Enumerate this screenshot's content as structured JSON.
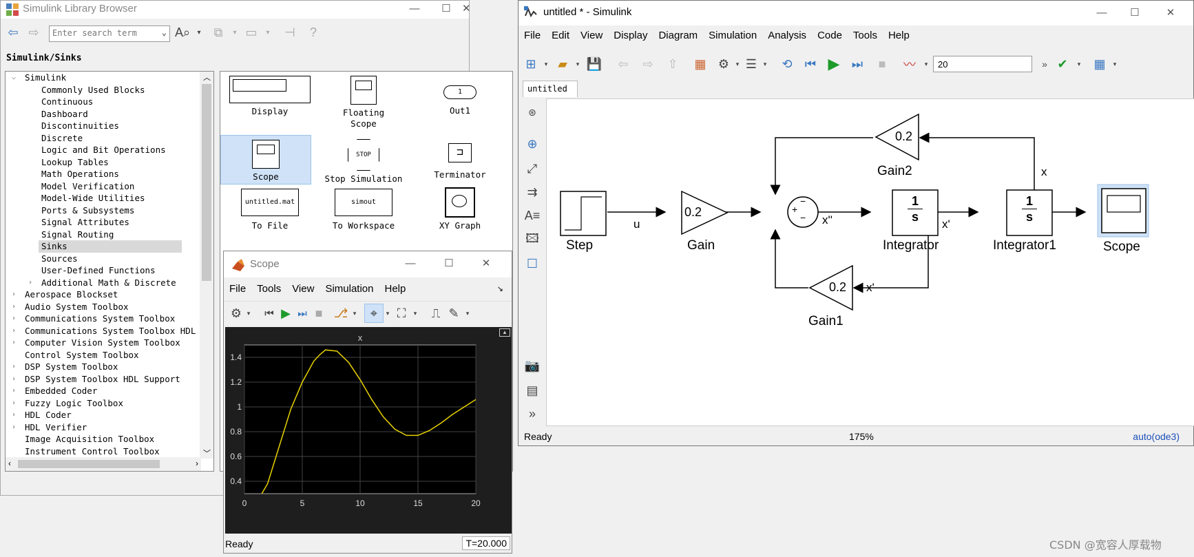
{
  "library": {
    "title": "Simulink Library Browser",
    "search_placeholder": "Enter search term",
    "path": "Simulink/Sinks",
    "tree": [
      {
        "label": "Simulink",
        "level": 0,
        "arrow": "v"
      },
      {
        "label": "Commonly Used Blocks",
        "level": 1
      },
      {
        "label": "Continuous",
        "level": 1
      },
      {
        "label": "Dashboard",
        "level": 1
      },
      {
        "label": "Discontinuities",
        "level": 1
      },
      {
        "label": "Discrete",
        "level": 1
      },
      {
        "label": "Logic and Bit Operations",
        "level": 1
      },
      {
        "label": "Lookup Tables",
        "level": 1
      },
      {
        "label": "Math Operations",
        "level": 1
      },
      {
        "label": "Model Verification",
        "level": 1
      },
      {
        "label": "Model-Wide Utilities",
        "level": 1
      },
      {
        "label": "Ports & Subsystems",
        "level": 1
      },
      {
        "label": "Signal Attributes",
        "level": 1
      },
      {
        "label": "Signal Routing",
        "level": 1
      },
      {
        "label": "Sinks",
        "level": 1,
        "selected": true
      },
      {
        "label": "Sources",
        "level": 1
      },
      {
        "label": "User-Defined Functions",
        "level": 1
      },
      {
        "label": "Additional Math & Discrete",
        "level": 1,
        "arrow": ">"
      },
      {
        "label": "Aerospace Blockset",
        "level": 0,
        "arrow": ">"
      },
      {
        "label": "Audio System Toolbox",
        "level": 0,
        "arrow": ">"
      },
      {
        "label": "Communications System Toolbox",
        "level": 0,
        "arrow": ">"
      },
      {
        "label": "Communications System Toolbox HDL",
        "level": 0,
        "arrow": ">"
      },
      {
        "label": "Computer Vision System Toolbox",
        "level": 0,
        "arrow": ">"
      },
      {
        "label": "Control System Toolbox",
        "level": 0
      },
      {
        "label": "DSP System Toolbox",
        "level": 0,
        "arrow": ">"
      },
      {
        "label": "DSP System Toolbox HDL Support",
        "level": 0,
        "arrow": ">"
      },
      {
        "label": "Embedded Coder",
        "level": 0,
        "arrow": ">"
      },
      {
        "label": "Fuzzy Logic Toolbox",
        "level": 0,
        "arrow": ">"
      },
      {
        "label": "HDL Coder",
        "level": 0,
        "arrow": ">"
      },
      {
        "label": "HDL Verifier",
        "level": 0,
        "arrow": ">"
      },
      {
        "label": "Image Acquisition Toolbox",
        "level": 0
      },
      {
        "label": "Instrument Control Toolbox",
        "level": 0
      }
    ],
    "blocks": {
      "display": "Display",
      "floating_scope": "Floating Scope",
      "out1": "Out1",
      "out1_port": "1",
      "scope": "Scope",
      "stop_simulation": "Stop Simulation",
      "stop_text": "STOP",
      "terminator": "Terminator",
      "to_file": "To File",
      "to_file_text": "untitled.mat",
      "to_workspace": "To Workspace",
      "to_workspace_text": "simout",
      "xy_graph": "XY Graph"
    }
  },
  "scope": {
    "title": "Scope",
    "menu": [
      "File",
      "Tools",
      "View",
      "Simulation",
      "Help"
    ],
    "status": "Ready",
    "time": "T=20.000"
  },
  "chart_data": {
    "type": "line",
    "title": "x",
    "xlim": [
      0,
      20
    ],
    "ylim": [
      0.3,
      1.5
    ],
    "xticks": [
      "0",
      "5",
      "10",
      "15",
      "20"
    ],
    "yticks": [
      "0.4",
      "0.6",
      "0.8",
      "1",
      "1.2",
      "1.4"
    ],
    "grid": true,
    "line_color": "#e8d200",
    "background": "#000000",
    "series": [
      {
        "x": [
          1.5,
          2,
          3,
          4,
          5,
          6,
          6.5,
          7,
          8,
          9,
          10,
          11,
          12,
          13,
          14,
          15,
          16,
          17,
          18,
          19,
          20
        ],
        "y": [
          0.3,
          0.38,
          0.68,
          0.98,
          1.2,
          1.37,
          1.42,
          1.46,
          1.45,
          1.36,
          1.22,
          1.06,
          0.92,
          0.82,
          0.77,
          0.77,
          0.81,
          0.87,
          0.94,
          1.0,
          1.06
        ]
      }
    ]
  },
  "simulink": {
    "title": "untitled * - Simulink",
    "menu": [
      "File",
      "Edit",
      "View",
      "Display",
      "Diagram",
      "Simulation",
      "Analysis",
      "Code",
      "Tools",
      "Help"
    ],
    "stop_time": "20",
    "tab": "untitled",
    "status_ready": "Ready",
    "zoom": "175%",
    "solver": "auto(ode3)",
    "blocks": {
      "step": "Step",
      "gain": "Gain",
      "gain_value": "0.2",
      "gain1": "Gain1",
      "gain1_value": "0.2",
      "gain2": "Gain2",
      "gain2_value": "0.2",
      "integrator": "Integrator",
      "integrator1": "Integrator1",
      "scope": "Scope",
      "int_num": "1",
      "int_den": "s",
      "sum_plus": "+",
      "sum_minus_top": "−",
      "sum_minus_bottom": "−"
    },
    "signals": {
      "u": "u",
      "xdd": "x''",
      "xd": "x'",
      "xd2": "x'",
      "x": "x"
    }
  },
  "watermark": "CSDN @宽容人厚载物"
}
